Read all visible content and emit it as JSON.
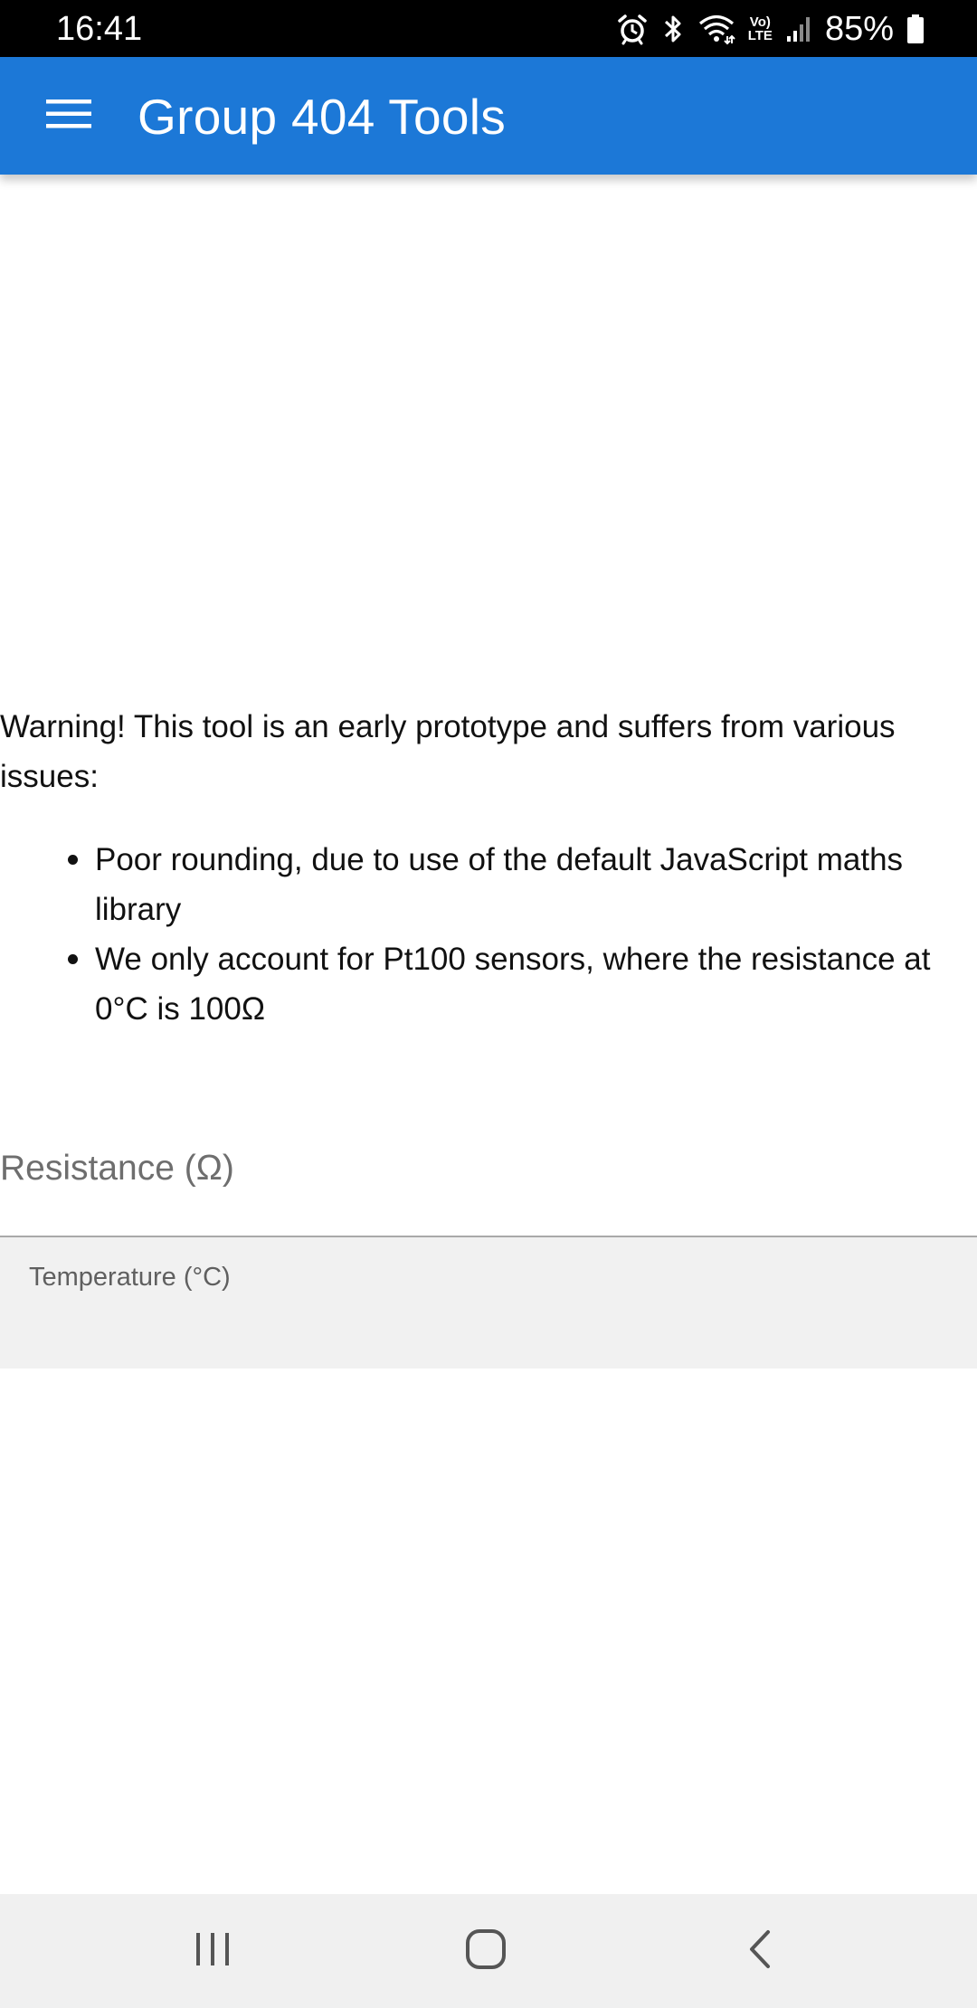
{
  "status_bar": {
    "time": "16:41",
    "battery_percent": "85%",
    "icons": [
      "alarm-icon",
      "bluetooth-icon",
      "wifi-icon",
      "volte-icon",
      "signal-icon",
      "battery-icon"
    ],
    "volte_line1": "Vo)",
    "volte_line2": "LTE"
  },
  "app_bar": {
    "title": "Group 404 Tools",
    "menu_icon": "menu-icon",
    "color": "#1c78d7"
  },
  "warning": {
    "text": "Warning! This tool is an early prototype and suffers from various issues:",
    "issues": [
      "Poor rounding, due to use of the default JavaScript maths library",
      "We only account for Pt100 sensors, where the resistance at 0°C is 100Ω"
    ]
  },
  "form": {
    "resistance_label": "Resistance (Ω)",
    "resistance_value": "",
    "temperature_label": "Temperature (°C)",
    "temperature_value": ""
  },
  "nav_bar": {
    "icons": [
      "recent-apps-icon",
      "home-icon",
      "back-icon"
    ]
  }
}
